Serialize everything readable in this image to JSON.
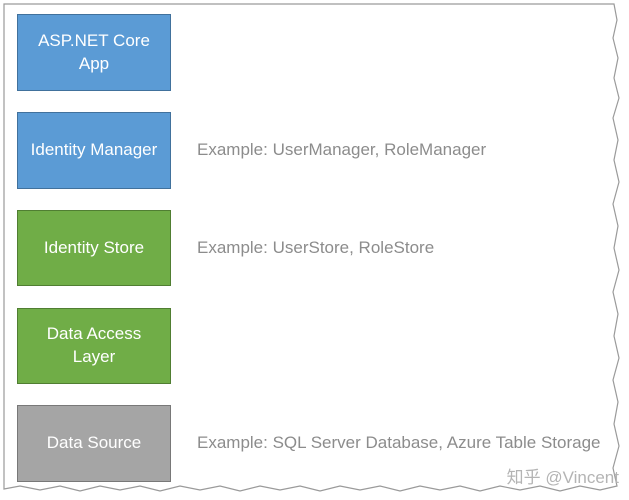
{
  "layers": [
    {
      "label": "ASP.NET Core\nApp",
      "example": "",
      "color": "#5b9bd5"
    },
    {
      "label": "Identity Manager",
      "example": "Example: UserManager, RoleManager",
      "color": "#5b9bd5"
    },
    {
      "label": "Identity Store",
      "example": "Example: UserStore, RoleStore",
      "color": "#70ad47"
    },
    {
      "label": "Data Access\nLayer",
      "example": "",
      "color": "#70ad47"
    },
    {
      "label": "Data Source",
      "example": "Example: SQL Server Database, Azure Table Storage",
      "color": "#a5a5a5"
    }
  ],
  "watermark": "知乎 @Vincent"
}
